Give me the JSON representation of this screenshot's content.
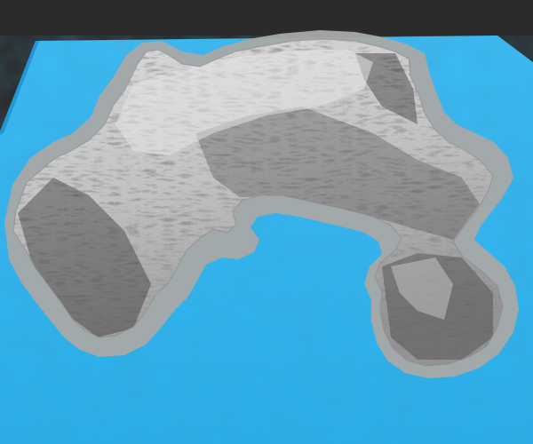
{
  "scene": {
    "background_color": "#2b2b2b",
    "water_color": "#2fb2ee",
    "water_dark_color": "#1f95d6",
    "shallow_color": "#a9a9a6",
    "land_light_color": "#dcdcdc",
    "land_mid_color": "#b4b4b4",
    "land_dark_color": "#5e5e5e"
  }
}
